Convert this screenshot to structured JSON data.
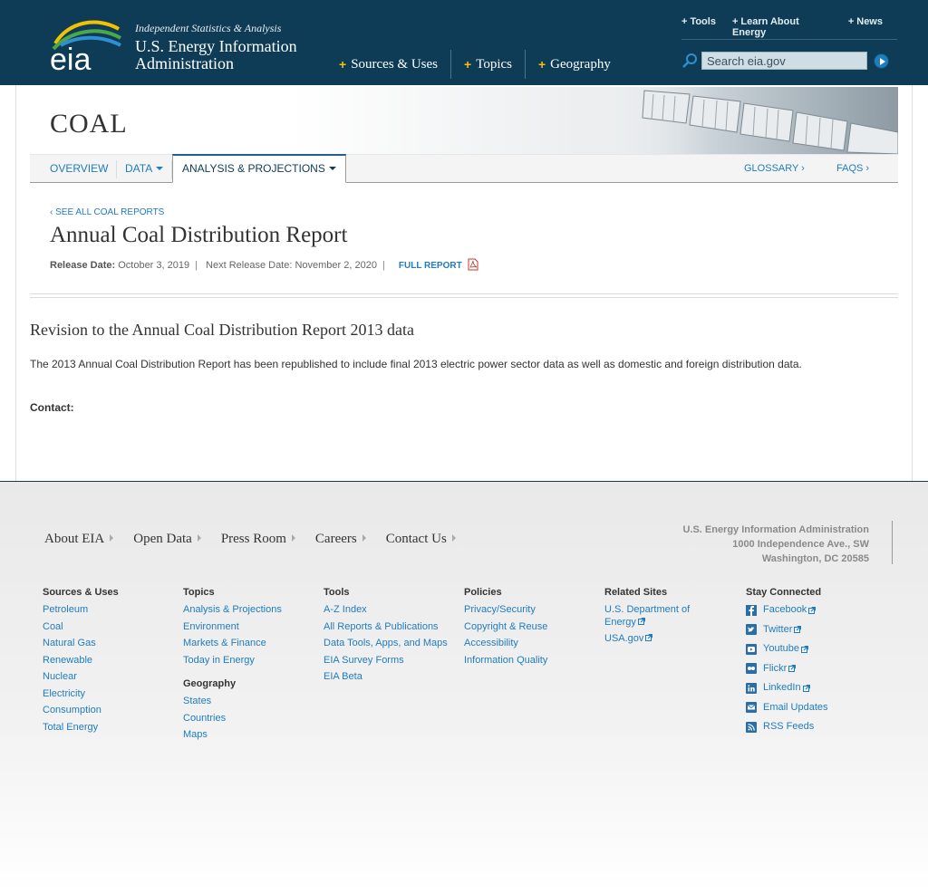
{
  "header": {
    "tagline": "Independent Statistics & Analysis",
    "agency_name": "U.S. Energy Information Administration",
    "logo_text": "eia",
    "top_links": [
      {
        "label": "Tools"
      },
      {
        "label": "Learn About Energy"
      },
      {
        "label": "News"
      }
    ],
    "main_nav": [
      {
        "label": "Sources & Uses"
      },
      {
        "label": "Topics"
      },
      {
        "label": "Geography"
      }
    ],
    "search": {
      "placeholder": "Search eia.gov"
    }
  },
  "banner": {
    "title": "COAL"
  },
  "subnav": {
    "overview": "OVERVIEW",
    "data": "DATA",
    "analysis": "ANALYSIS & PROJECTIONS",
    "glossary": "GLOSSARY ›",
    "faqs": "FAQS ›"
  },
  "report": {
    "see_all": "‹ SEE ALL COAL REPORTS",
    "title": "Annual Coal Distribution Report",
    "release_label": "Release Date:",
    "release_date": "October 3, 2019",
    "next_release": "Next Release Date: November 2, 2020",
    "full_report": "FULL REPORT"
  },
  "revision": {
    "title": "Revision to the Annual Coal Distribution Report 2013 data",
    "body": "The 2013 Annual Coal Distribution Report has been republished to include final 2013 electric power sector data as well as domestic and foreign distribution data.",
    "contact_label": "Contact:"
  },
  "footer": {
    "nav": [
      "About EIA",
      "Open Data",
      "Press Room",
      "Careers",
      "Contact Us"
    ],
    "address": [
      "U.S. Energy Information Administration",
      "1000 Independence Ave., SW",
      "Washington, DC 20585"
    ],
    "columns": {
      "sources": {
        "heading": "Sources & Uses",
        "links": [
          "Petroleum",
          "Coal",
          "Natural Gas",
          "Renewable",
          "Nuclear",
          "Electricity",
          "Consumption",
          "Total Energy"
        ]
      },
      "topics": {
        "heading": "Topics",
        "links": [
          "Analysis & Projections",
          "Environment",
          "Markets & Finance",
          "Today in Energy"
        ]
      },
      "geography": {
        "heading": "Geography",
        "links": [
          "States",
          "Countries",
          "Maps"
        ]
      },
      "tools": {
        "heading": "Tools",
        "links": [
          "A-Z Index",
          "All Reports & Publications",
          "Data Tools, Apps, and Maps",
          "EIA Survey Forms",
          "EIA Beta"
        ]
      },
      "policies": {
        "heading": "Policies",
        "links": [
          "Privacy/Security",
          "Copyright & Reuse",
          "Accessibility",
          "Information Quality"
        ]
      },
      "related": {
        "heading": "Related Sites",
        "links": [
          "U.S. Department of Energy",
          "USA.gov"
        ]
      },
      "social": {
        "heading": "Stay Connected",
        "links": [
          "Facebook",
          "Twitter",
          "Youtube",
          "Flickr",
          "LinkedIn",
          "Email Updates",
          "RSS Feeds"
        ]
      }
    }
  },
  "colors": {
    "header_bg": "#0e3c57",
    "link": "#1f7cbf",
    "accent_plus": "#f2c200"
  }
}
